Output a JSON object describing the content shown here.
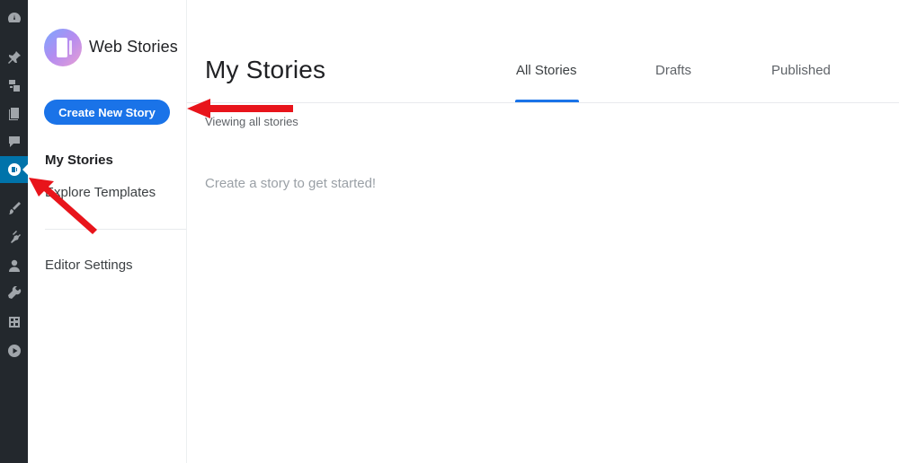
{
  "wp_sidebar": {
    "icons": [
      "dashboard-icon",
      "pin-icon",
      "media-icon",
      "pages-icon",
      "comments-icon",
      "web-stories-icon",
      "appearance-icon",
      "plugins-icon",
      "users-icon",
      "tools-icon",
      "settings-icon",
      "play-icon"
    ]
  },
  "brand": {
    "name": "Web Stories"
  },
  "sidebar": {
    "create_label": "Create New Story",
    "items": [
      {
        "label": "My Stories"
      },
      {
        "label": "Explore Templates"
      },
      {
        "label": "Editor Settings"
      }
    ]
  },
  "main": {
    "title": "My Stories",
    "tabs": [
      {
        "label": "All Stories"
      },
      {
        "label": "Drafts"
      },
      {
        "label": "Published"
      }
    ],
    "subtitle": "Viewing all stories",
    "empty_message": "Create a story to get started!"
  },
  "colors": {
    "accent": "#1a73e8",
    "wp_bar": "#23282d",
    "wp_active": "#0073aa",
    "annotation_arrow": "#e8141b"
  }
}
